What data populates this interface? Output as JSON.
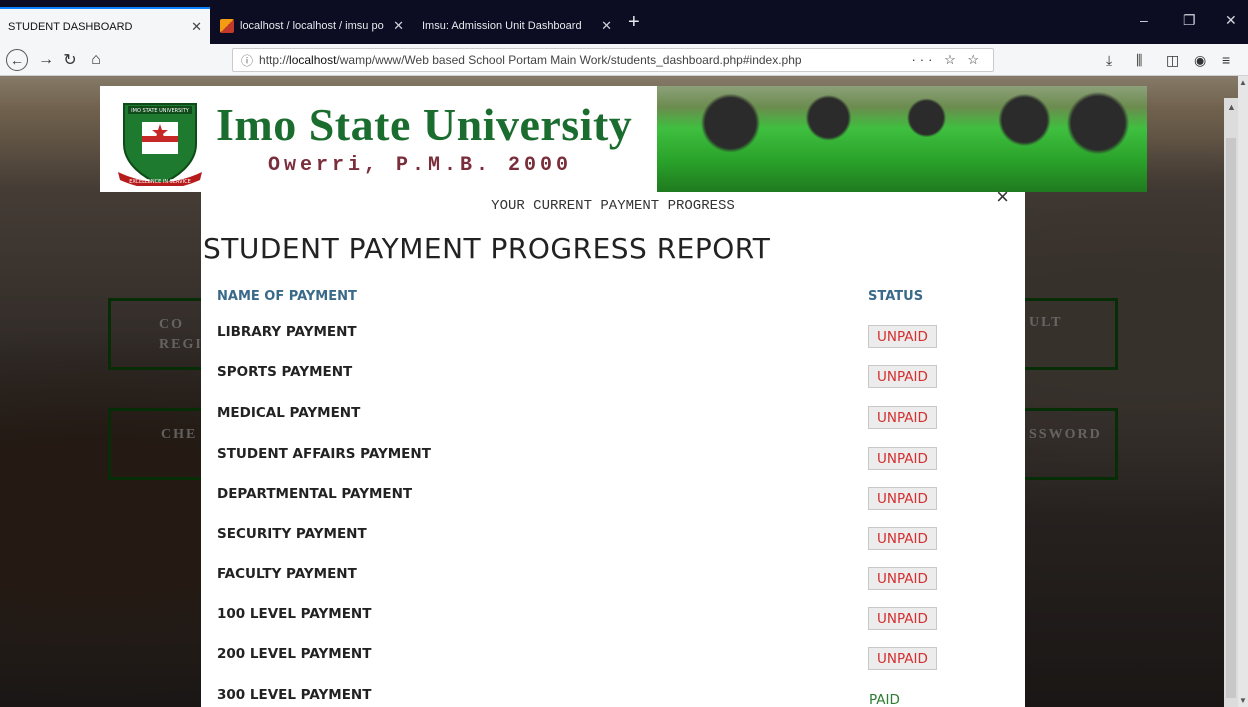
{
  "browser": {
    "tabs": [
      {
        "label": "STUDENT DASHBOARD",
        "active": true
      },
      {
        "label": "localhost / localhost / imsu po",
        "active": false
      },
      {
        "label": "Imsu: Admission Unit Dashboard",
        "active": false
      }
    ],
    "url_prefix": "http://",
    "url_host": "localhost",
    "url_path": "/wamp/www/Web based School Portam Main Work/students_dashboard.php#index.php",
    "url_actions": "··· ☆ ☆"
  },
  "header": {
    "university_name": "Imo State University",
    "subtitle": "Owerri, P.M.B. 2000",
    "crest_motto": "EXCELLENCE IN SERVICE",
    "crest_top": "IMO STATE UNIVERSITY"
  },
  "background_tiles": [
    {
      "label": "CO\nREGI"
    },
    {
      "label": "ULT"
    },
    {
      "label": "CHE"
    },
    {
      "label": "SSWORD"
    }
  ],
  "modal": {
    "subtitle": "YOUR CURRENT PAYMENT PROGRESS",
    "title": "STUDENT PAYMENT PROGRESS REPORT",
    "col_name": "NAME OF PAYMENT",
    "col_status": "STATUS",
    "close": "×",
    "rows": [
      {
        "name": "LIBRARY PAYMENT",
        "status": "UNPAID"
      },
      {
        "name": "SPORTS PAYMENT",
        "status": "UNPAID"
      },
      {
        "name": "MEDICAL PAYMENT",
        "status": "UNPAID"
      },
      {
        "name": "STUDENT AFFAIRS PAYMENT",
        "status": "UNPAID"
      },
      {
        "name": "DEPARTMENTAL PAYMENT",
        "status": "UNPAID"
      },
      {
        "name": "SECURITY PAYMENT",
        "status": "UNPAID"
      },
      {
        "name": "FACULTY PAYMENT",
        "status": "UNPAID"
      },
      {
        "name": "100 LEVEL PAYMENT",
        "status": "UNPAID"
      },
      {
        "name": "200 LEVEL PAYMENT",
        "status": "UNPAID"
      },
      {
        "name": "300 LEVEL PAYMENT",
        "status": "PAID"
      }
    ]
  },
  "colors": {
    "unpaid": "#d32f2f",
    "paid": "#2e7d32",
    "header_green": "#1b6d2f",
    "subtitle_maroon": "#7a2d3a",
    "column_header": "#3a6a8a"
  }
}
